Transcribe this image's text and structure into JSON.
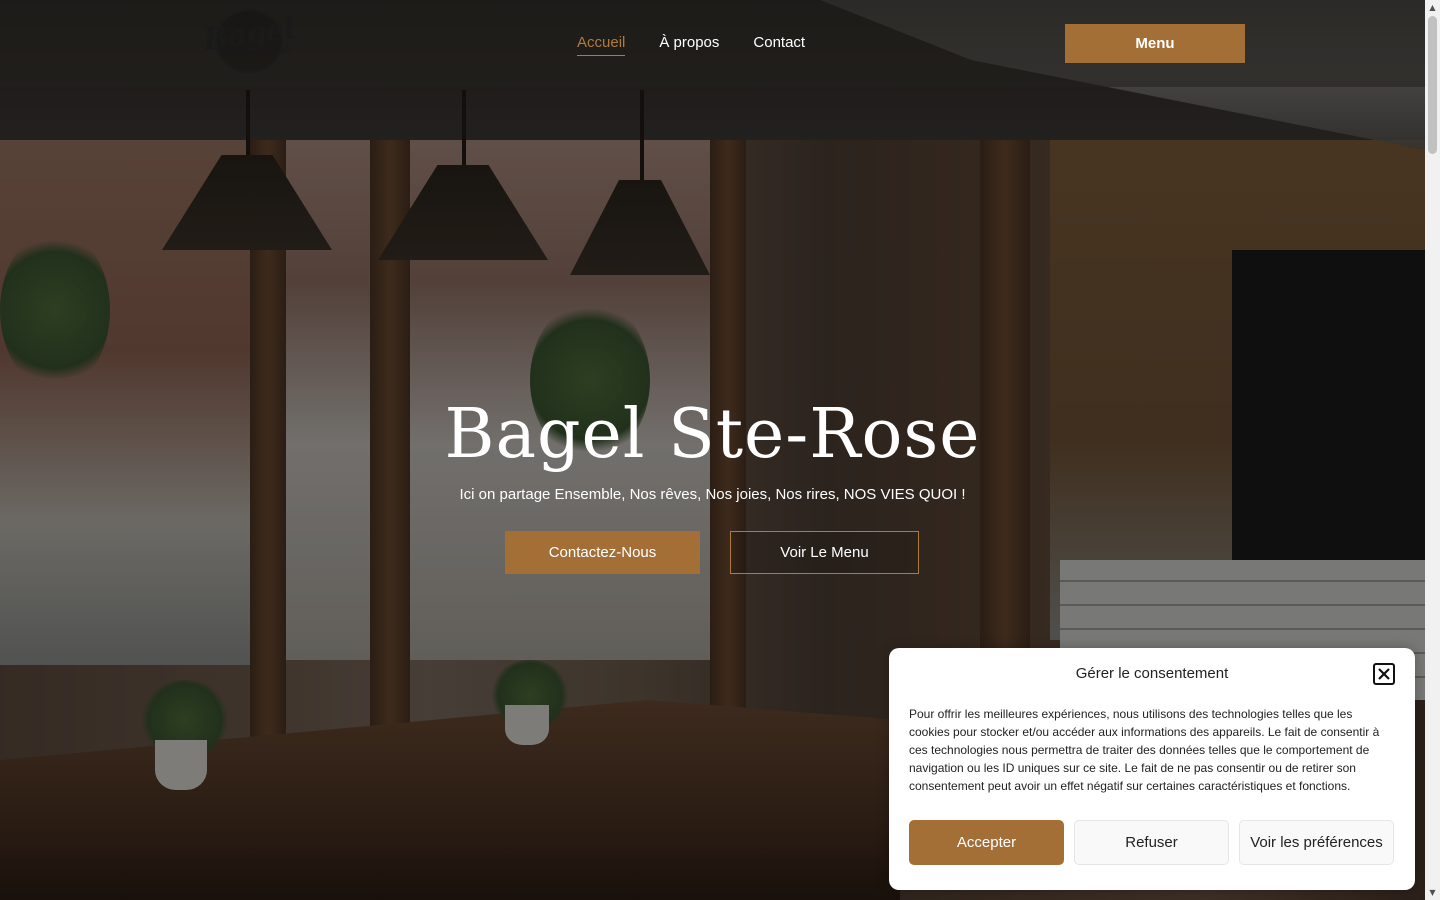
{
  "logo": {
    "word": "Bagel",
    "top_small": "1987",
    "side_small": "STE-ROSE"
  },
  "nav": {
    "items": [
      {
        "label": "Accueil",
        "active": true
      },
      {
        "label": "À propos",
        "active": false
      },
      {
        "label": "Contact",
        "active": false
      }
    ],
    "menu_button": "Menu"
  },
  "hero": {
    "title": "Bagel Ste-Rose",
    "subtitle": "Ici on partage Ensemble, Nos rêves, Nos joies, Nos rires, NOS VIES QUOI !",
    "primary_cta": "Contactez-Nous",
    "secondary_cta": "Voir Le Menu"
  },
  "consent": {
    "title": "Gérer le consentement",
    "body": "Pour offrir les meilleures expériences, nous utilisons des technologies telles que les cookies pour stocker et/ou accéder aux informations des appareils. Le fait de consentir à ces technologies nous permettra de traiter des données telles que le comportement de navigation ou les ID uniques sur ce site. Le fait de ne pas consentir ou de retirer son consentement peut avoir un effet négatif sur certaines caractéristiques et fonctions.",
    "accept": "Accepter",
    "refuse": "Refuser",
    "preferences": "Voir les préférences"
  },
  "colors": {
    "accent": "#a46f36",
    "nav_active": "#b07a3d",
    "header_bg": "#23201e"
  }
}
